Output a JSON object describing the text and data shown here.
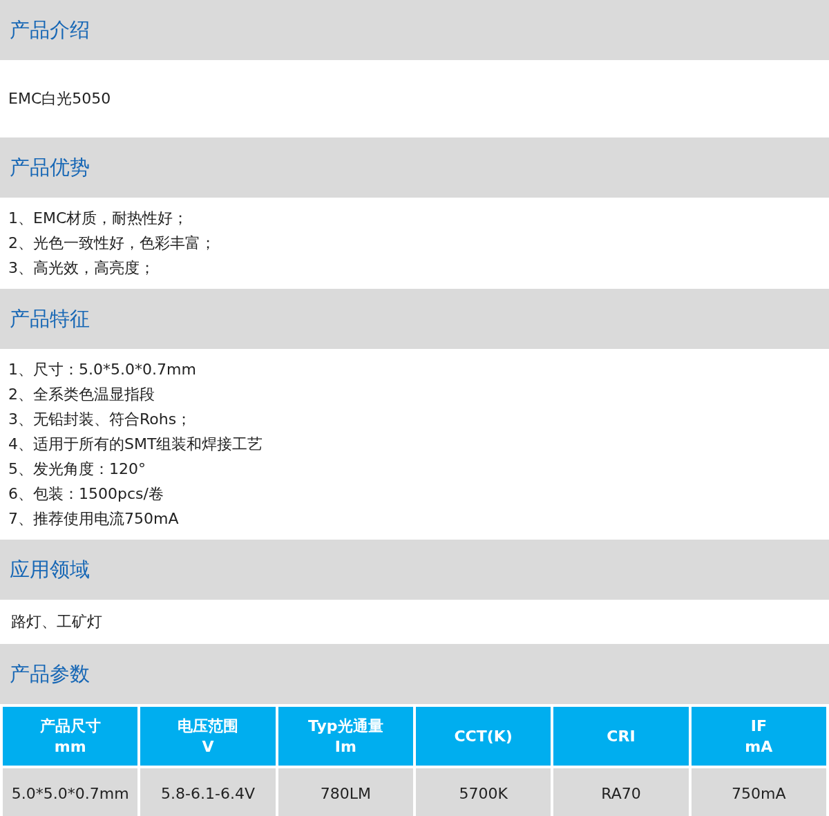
{
  "sections": [
    {
      "title": "产品介绍",
      "kind": "text",
      "text": "EMC白光5050"
    },
    {
      "title": "产品优势",
      "kind": "list",
      "items": [
        "1、EMC材质，耐热性好；",
        "2、光色一致性好，色彩丰富；",
        "3、高光效，高亮度；"
      ]
    },
    {
      "title": "产品特征",
      "kind": "list",
      "items": [
        "1、尺寸：5.0*5.0*0.7mm",
        "2、全系类色温显指段",
        "3、无铅封装、符合Rohs；",
        "4、适用于所有的SMT组装和焊接工艺",
        "5、发光角度：120°",
        "6、包装：1500pcs/卷",
        "7、推荐使用电流750mA"
      ]
    },
    {
      "title": "应用领域",
      "kind": "text",
      "text": "路灯、工矿灯"
    },
    {
      "title": "产品参数",
      "kind": "table",
      "columns": [
        "产品尺寸\nmm",
        "电压范围\nV",
        "Typ光通量\nIm",
        "CCT(K)",
        "CRI",
        "IF\nmA"
      ],
      "rows": [
        [
          "5.0*5.0*0.7mm",
          "5.8-6.1-6.4V",
          "780LM",
          "5700K",
          "RA70",
          "750mA"
        ]
      ]
    }
  ]
}
